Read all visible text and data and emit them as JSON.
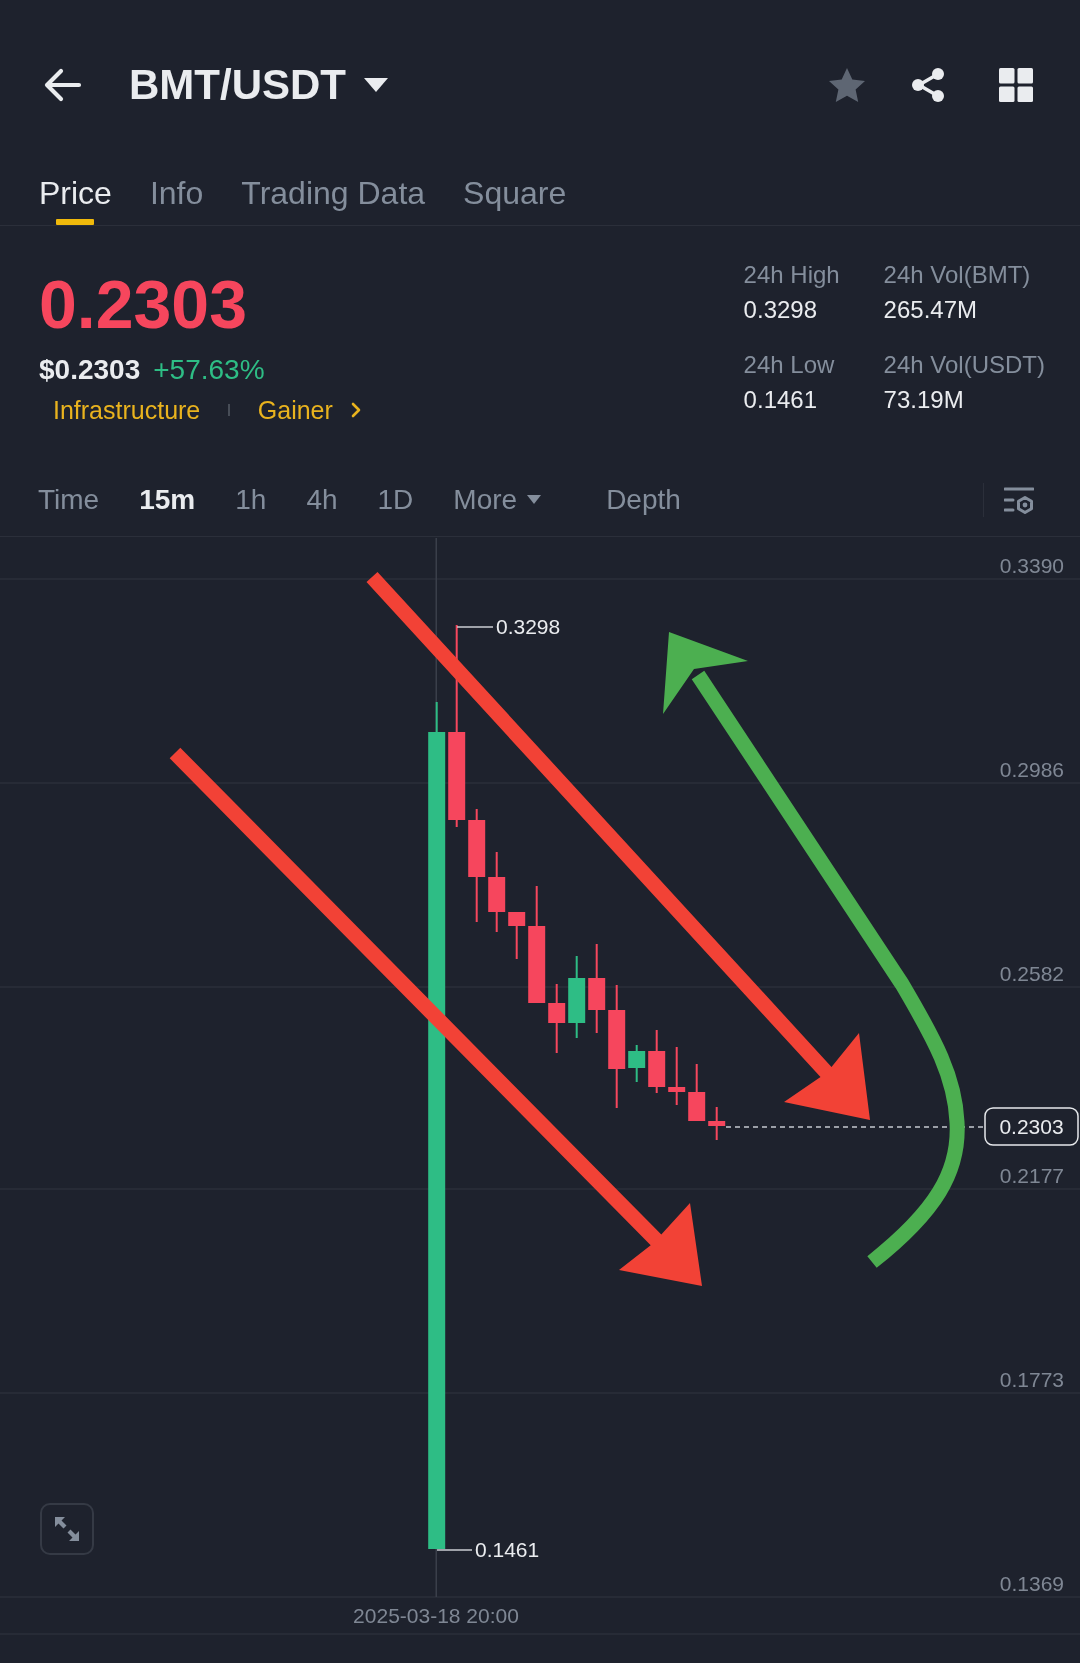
{
  "header": {
    "pair": "BMT/USDT",
    "favorite": false
  },
  "tabs": [
    {
      "label": "Price",
      "selected": true
    },
    {
      "label": "Info",
      "selected": false
    },
    {
      "label": "Trading Data",
      "selected": false
    },
    {
      "label": "Square",
      "selected": false
    }
  ],
  "ticker": {
    "last_price": "0.2303",
    "last_price_rising": false,
    "fiat_price": "$0.2303",
    "change": "+57.63%",
    "change_rising": true,
    "tags": [
      "Infrastructure",
      "Gainer"
    ],
    "stats": [
      {
        "label": "24h High",
        "value": "0.3298"
      },
      {
        "label": "24h Vol(BMT)",
        "value": "265.47M"
      },
      {
        "label": "24h Low",
        "value": "0.1461"
      },
      {
        "label": "24h Vol(USDT)",
        "value": "73.19M"
      }
    ]
  },
  "intervals": [
    {
      "label": "Time",
      "kind": "option",
      "selected": false
    },
    {
      "label": "15m",
      "kind": "option",
      "selected": true
    },
    {
      "label": "1h",
      "kind": "option",
      "selected": false
    },
    {
      "label": "4h",
      "kind": "option",
      "selected": false
    },
    {
      "label": "1D",
      "kind": "option",
      "selected": false
    },
    {
      "label": "More",
      "kind": "menu",
      "selected": false
    },
    {
      "label": "Depth",
      "kind": "view",
      "selected": false
    }
  ],
  "chart": {
    "price_labels": [
      "0.3390",
      "0.2986",
      "0.2582",
      "0.2177",
      "0.1773",
      "0.1369"
    ],
    "high_label": "0.3298",
    "low_label": "0.1461",
    "last_price_tag": "0.2303",
    "time_label": "2025-03-18 20:00"
  }
}
